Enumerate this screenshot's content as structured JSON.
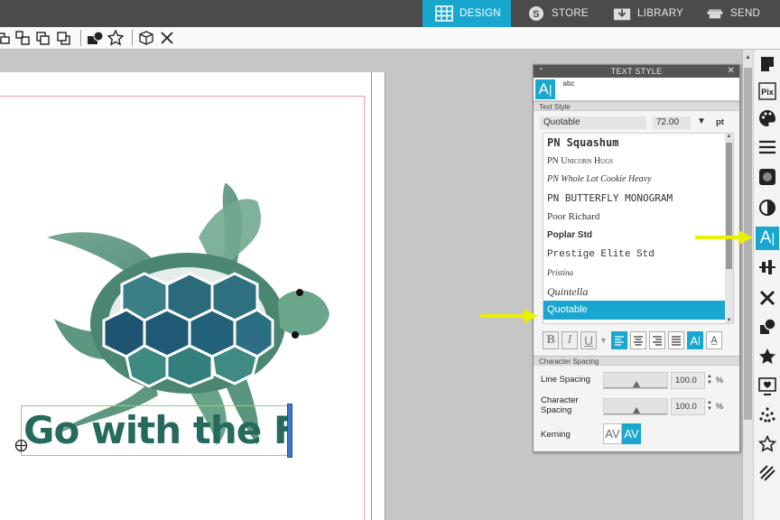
{
  "nav": {
    "tabs": [
      {
        "label": "DESIGN",
        "icon": "grid-icon",
        "active": true
      },
      {
        "label": "STORE",
        "icon": "store-s-icon",
        "active": false
      },
      {
        "label": "LIBRARY",
        "icon": "library-download-icon",
        "active": false
      },
      {
        "label": "SEND",
        "icon": "cutter-machine-icon",
        "active": false
      }
    ]
  },
  "toolbar": {
    "icons": [
      "group-icon",
      "ungroup-icon",
      "bring-forward-icon",
      "send-backward-icon",
      "fill-shape-icon",
      "star-replicate-icon",
      "3d-box-icon",
      "close-x-icon"
    ]
  },
  "text_style_panel": {
    "title": "TEXT STYLE",
    "tab_icons": [
      "text-style-icon",
      "abc-spell-icon"
    ],
    "section_text_style": "Text Style",
    "font_selected": "Quotable",
    "font_size": "72.00",
    "unit": "pt",
    "font_list": [
      "PN Squashum",
      "PN Unicorn Hugs",
      "PN Whole Lot Cookie Heavy",
      "PN BUTTERFLY MONOGRAM",
      "Poor Richard",
      "Poplar Std",
      "Prestige Elite Std",
      "Pristina",
      "Quintella",
      "Quotable"
    ],
    "format_buttons": {
      "bold": "B",
      "italic": "I",
      "underline": "U"
    },
    "section_character_spacing": "Character Spacing",
    "line_spacing_label": "Line Spacing",
    "line_spacing_value": "100.0",
    "char_spacing_label": "Character Spacing",
    "char_spacing_value": "100.0",
    "percent": "%",
    "kerning_label": "Kerning",
    "kerning_glyph": "AV"
  },
  "canvas": {
    "text_object": "Go with the Flow"
  },
  "right_panel_icons": [
    "page-setup-icon",
    "pixscan-icon",
    "design-store-palette-icon",
    "line-style-icon",
    "fill-icon",
    "contrast-icon",
    "text-style-icon",
    "align-icon",
    "transform-icon",
    "modify-icon",
    "star-replicate-icon",
    "trace-icon",
    "dots-icon",
    "star-outline-icon",
    "sketch-icon"
  ],
  "colors": {
    "accent": "#1aa7cf",
    "turtle_green": "#5f9b82",
    "turtle_blue": "#215e72",
    "highlight_arrow": "#e9f000"
  }
}
